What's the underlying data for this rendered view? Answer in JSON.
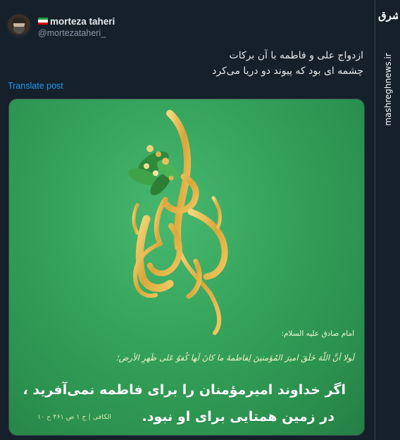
{
  "colors": {
    "background": "#15202b",
    "primary_text": "#e7e9ea",
    "secondary_text": "#8b98a5",
    "link": "#1d9bf0",
    "media_green": "#35a35b",
    "calligraphy_gold": "#e2b64a"
  },
  "branding": {
    "logo_text": "مشرق",
    "url": "mashreghnews.ir"
  },
  "author": {
    "flag_icon": "iran-flag-icon",
    "display_name": "morteza taheri",
    "handle": "@mortezataheri_"
  },
  "post": {
    "line1": "ازدواج علی و فاطمه با آن برکات",
    "line2": "چشمه ای بود که پیوند دو دریا می‌کرد",
    "translate_label": "Translate post"
  },
  "media": {
    "calligraphy_word_1": "علی",
    "calligraphy_word_2": "فاطمه",
    "quote_intro": "امام صادق علیه السلام:",
    "arabic_text": "لَولا أنَّ اللّهَ خَلَقَ امیرَ المُؤمنینَ لِفاطمةَ ما کانَ لَها کُفوٌ عَلی ظَهرِ الأرض؛",
    "persian_line1": "اگر خداوند امیرمؤمنان را برای فاطمه نمی‌آفرید ،",
    "persian_line2": "در زمین همتایی برای او نبود.",
    "source": "الکافی | ج ۱ ص ۴۶۱ ح ۱۰"
  }
}
